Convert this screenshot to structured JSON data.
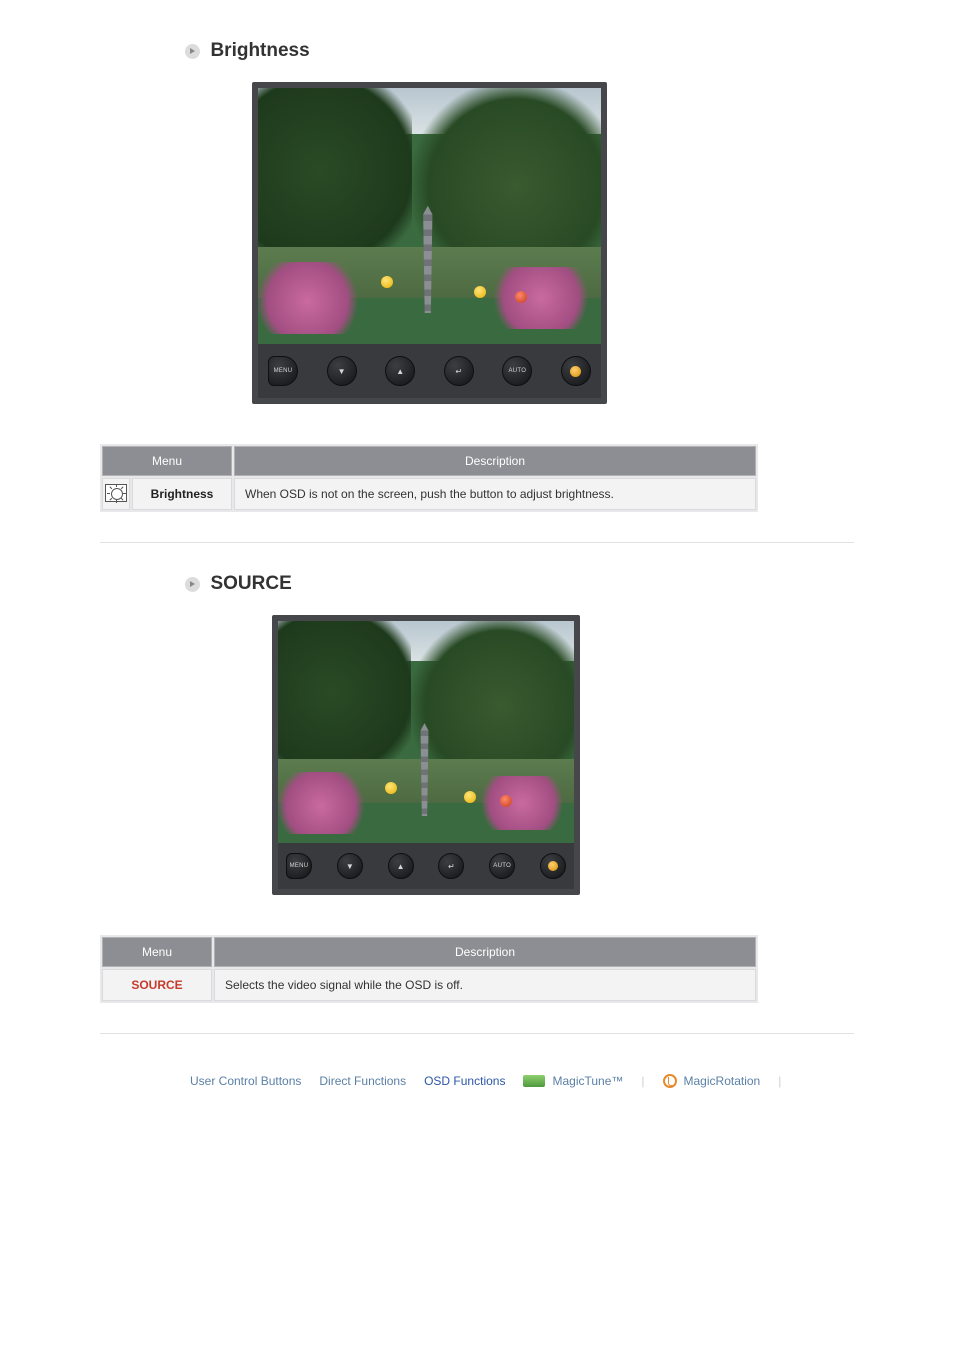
{
  "sections": {
    "brightness": {
      "heading": "Brightness",
      "monitor_buttons": {
        "menu": "MENU",
        "down": "▼",
        "up": "▲",
        "enter": "↵",
        "auto": "AUTO"
      },
      "table": {
        "header_menu": "Menu",
        "header_desc": "Description",
        "menu_label": "Brightness",
        "description": "When OSD is not on the screen, push the button to adjust brightness."
      }
    },
    "source": {
      "heading": "SOURCE",
      "monitor_buttons": {
        "menu": "MENU",
        "down": "▼",
        "up": "▲",
        "enter": "↵",
        "auto": "AUTO"
      },
      "table": {
        "header_menu": "Menu",
        "header_desc": "Description",
        "menu_label": "SOURCE",
        "description": "Selects the video signal while the OSD is off."
      }
    }
  },
  "nav": {
    "user_control": "User Control Buttons",
    "direct": "Direct Functions",
    "osd": "OSD Functions",
    "magictune": "MagicTune™",
    "magicrotation": "MagicRotation"
  }
}
